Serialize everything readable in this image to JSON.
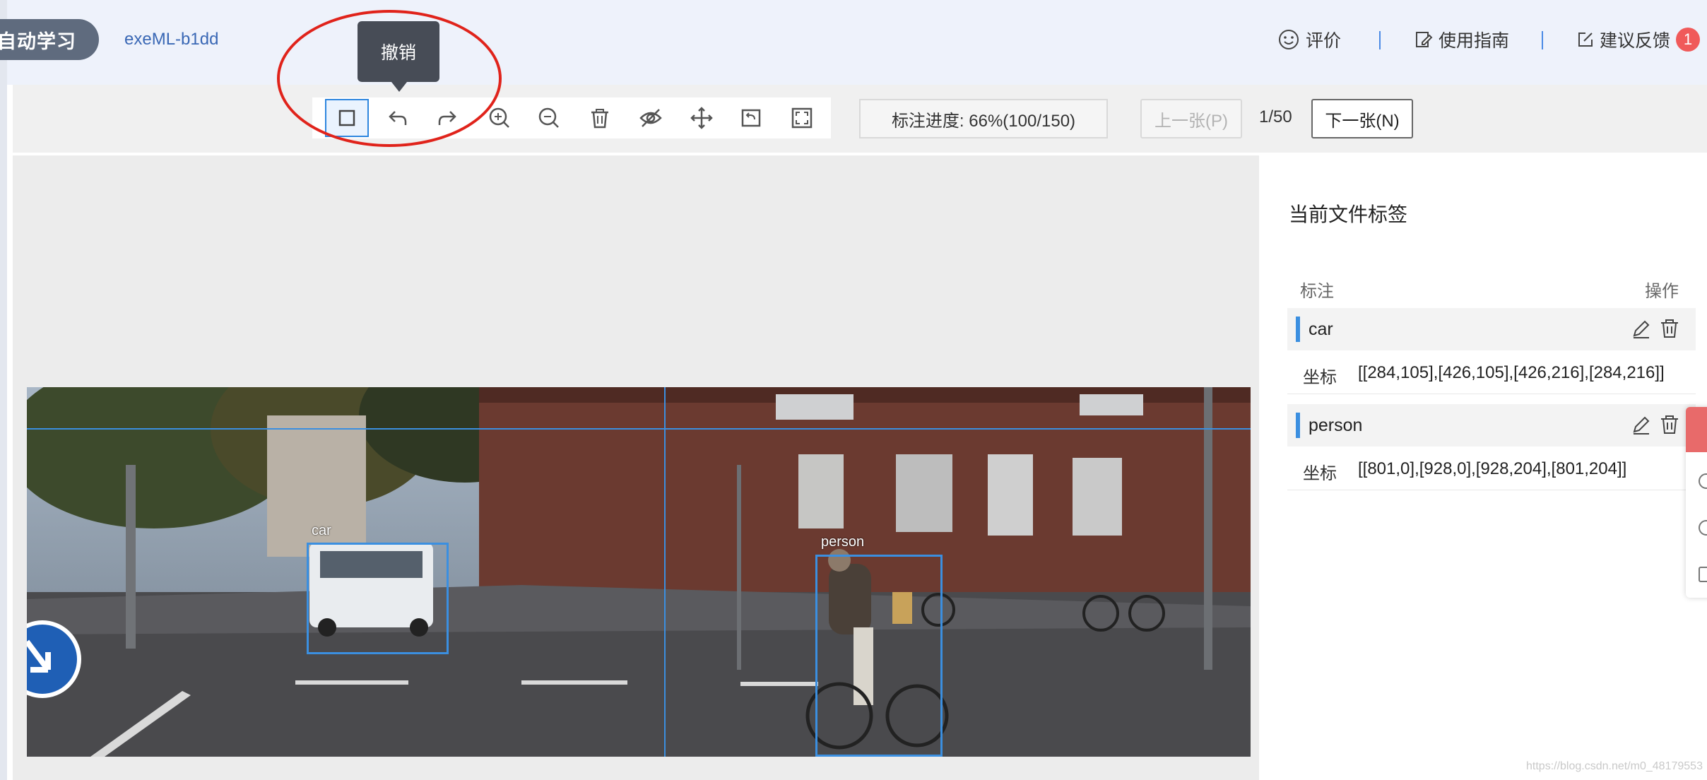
{
  "header": {
    "app_name": "自动学习",
    "project_name": "exeML-b1dd",
    "links": {
      "rate": "评价",
      "guide": "使用指南",
      "feedback": "建议反馈",
      "feedback_badge": "1"
    }
  },
  "tooltip": {
    "text": "撤销"
  },
  "toolbar": {
    "tools": [
      "rectangle-tool-icon",
      "undo-icon",
      "redo-icon",
      "zoom-in-icon",
      "zoom-out-icon",
      "delete-icon",
      "hide-icon",
      "move-icon",
      "reset-icon",
      "fit-screen-icon"
    ],
    "progress": "标注进度: 66%(100/150)",
    "progress_fraction": 0.66,
    "prev_label": "上一张(P)",
    "page_counter": "1/50",
    "next_label": "下一张(N)"
  },
  "canvas": {
    "boxes": [
      {
        "label": "car"
      },
      {
        "label": "person"
      }
    ]
  },
  "panel": {
    "title": "当前文件标签",
    "col_label": "标注",
    "col_actions": "操作",
    "labels": [
      {
        "name": "car",
        "coord_key": "坐标",
        "coords": "[[284,105],[426,105],[426,216],[284,216]]"
      },
      {
        "name": "person",
        "coord_key": "坐标",
        "coords": "[[801,0],[928,0],[928,204],[801,204]]"
      }
    ]
  },
  "watermark": "https://blog.csdn.net/m0_48179553",
  "colors": {
    "accent": "#3b8fe0",
    "badge": "#f05a5a",
    "pill": "#5f6b7e",
    "highlight": "#e0231b"
  }
}
